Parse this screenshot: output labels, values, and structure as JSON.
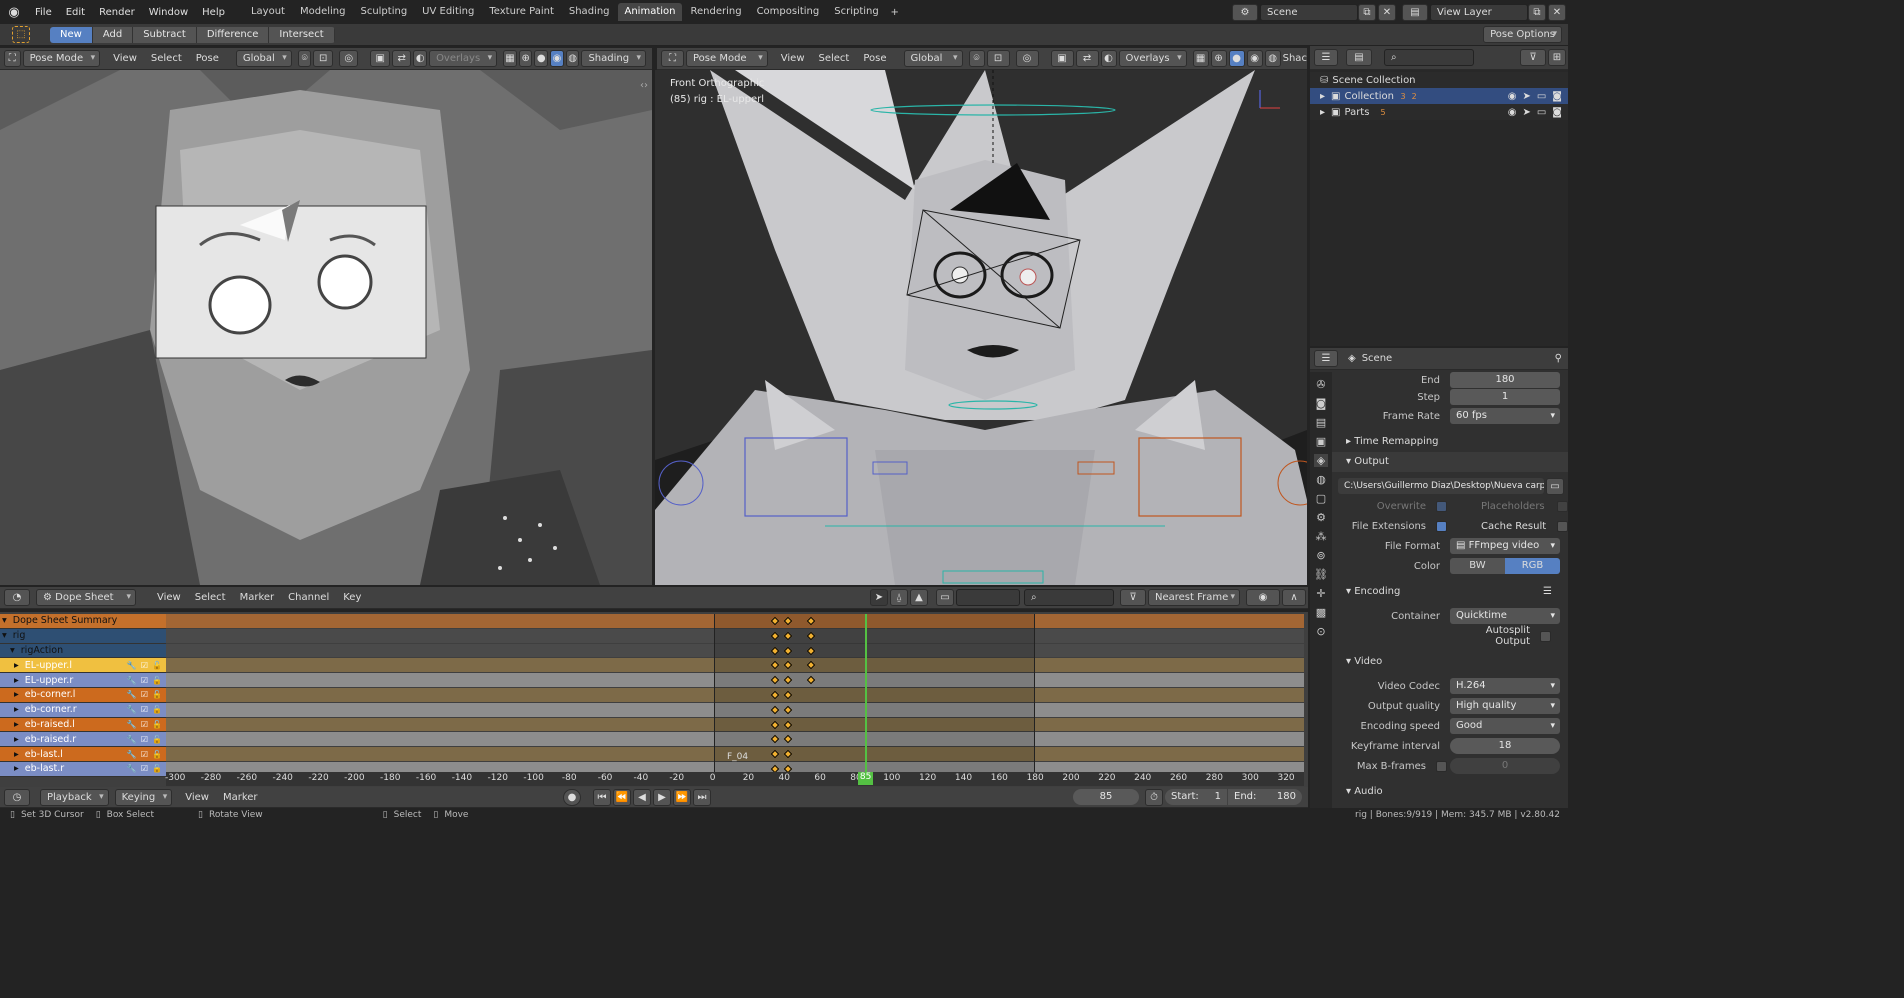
{
  "app": {
    "logo": "blender-logo-icon"
  },
  "topbar": {
    "menus": [
      "File",
      "Edit",
      "Render",
      "Window",
      "Help"
    ],
    "workspaces": [
      "Layout",
      "Modeling",
      "Sculpting",
      "UV Editing",
      "Texture Paint",
      "Shading",
      "Animation",
      "Rendering",
      "Compositing",
      "Scripting"
    ],
    "active_workspace": "Animation",
    "scene": "Scene",
    "view_layer": "View Layer"
  },
  "toolsettings": {
    "modes": [
      "New",
      "Add",
      "Subtract",
      "Difference",
      "Intersect"
    ],
    "active_mode": "New",
    "pose_options": "Pose Options"
  },
  "viewport_left": {
    "mode": "Pose Mode",
    "menus": [
      "View",
      "Select",
      "Pose"
    ],
    "orientation": "Global",
    "overlays": "Overlays",
    "shading": "Shading"
  },
  "viewport_right": {
    "mode": "Pose Mode",
    "menus": [
      "View",
      "Select",
      "Pose"
    ],
    "orientation": "Global",
    "overlays": "Overlays",
    "shading": "Shac",
    "view_name": "Front Orthographic",
    "active_info": "(85) rig : EL-upperl"
  },
  "outliner": {
    "search_placeholder": "",
    "root": "Scene Collection",
    "items": [
      {
        "name": "Collection",
        "badge1": "3",
        "badge2": "2"
      },
      {
        "name": "Parts",
        "badge1": "5"
      }
    ]
  },
  "properties": {
    "context": "Scene",
    "end_label": "End",
    "end_value": "180",
    "step_label": "Step",
    "step_value": "1",
    "frame_rate_label": "Frame Rate",
    "frame_rate_value": "60 fps",
    "time_remapping": "Time Remapping",
    "output_section": "Output",
    "output_path": "C:\\Users\\Guillermo Diaz\\Desktop\\Nueva carpe...",
    "overwrite": "Overwrite",
    "placeholders": "Placeholders",
    "file_extensions": "File Extensions",
    "cache_result": "Cache Result",
    "file_format_label": "File Format",
    "file_format_value": "FFmpeg video",
    "color_label": "Color",
    "color_bw": "BW",
    "color_rgb": "RGB",
    "encoding_section": "Encoding",
    "container_label": "Container",
    "container_value": "Quicktime",
    "autosplit": "Autosplit Output",
    "video_section": "Video",
    "video_codec_label": "Video Codec",
    "video_codec_value": "H.264",
    "output_quality_label": "Output quality",
    "output_quality_value": "High quality",
    "encoding_speed_label": "Encoding speed",
    "encoding_speed_value": "Good",
    "keyframe_interval_label": "Keyframe interval",
    "keyframe_interval_value": "18",
    "max_bframes_label": "Max B-frames",
    "max_bframes_value": "0",
    "audio_section": "Audio"
  },
  "dopesheet": {
    "mode": "Dope Sheet",
    "menus": [
      "View",
      "Select",
      "Marker",
      "Channel",
      "Key"
    ],
    "snap": "Nearest Frame",
    "channels": [
      {
        "name": "Dope Sheet Summary",
        "kind": "summary"
      },
      {
        "name": "rig",
        "kind": "object"
      },
      {
        "name": "rigAction",
        "kind": "action"
      },
      {
        "name": "EL-upper.l",
        "kind": "bone-l",
        "selected": true
      },
      {
        "name": "EL-upper.r",
        "kind": "bone-r"
      },
      {
        "name": "eb-corner.l",
        "kind": "bone-l"
      },
      {
        "name": "eb-corner.r",
        "kind": "bone-r"
      },
      {
        "name": "eb-raised.l",
        "kind": "bone-l"
      },
      {
        "name": "eb-raised.r",
        "kind": "bone-r"
      },
      {
        "name": "eb-last.l",
        "kind": "bone-l"
      },
      {
        "name": "eb-last.r",
        "kind": "bone-r"
      }
    ],
    "marker": "F_04",
    "ruler_ticks": [
      "-300",
      "-280",
      "-260",
      "-240",
      "-220",
      "-200",
      "-180",
      "-160",
      "-140",
      "-120",
      "-100",
      "-80",
      "-60",
      "-40",
      "-20",
      "0",
      "20",
      "40",
      "60",
      "80",
      "100",
      "120",
      "140",
      "160",
      "180",
      "200",
      "220",
      "240",
      "260",
      "280",
      "300",
      "320"
    ],
    "current_frame": "85"
  },
  "timeline": {
    "menus": [
      "Playback",
      "Keying",
      "View",
      "Marker"
    ],
    "current_frame": "85",
    "start_label": "Start:",
    "start_value": "1",
    "end_label": "End:",
    "end_value": "180"
  },
  "status": {
    "items": [
      "Set 3D Cursor",
      "Box Select",
      "Rotate View",
      "Select",
      "Move"
    ],
    "stats": "rig | Bones:9/919 | Mem: 345.7 MB | v2.80.42"
  }
}
